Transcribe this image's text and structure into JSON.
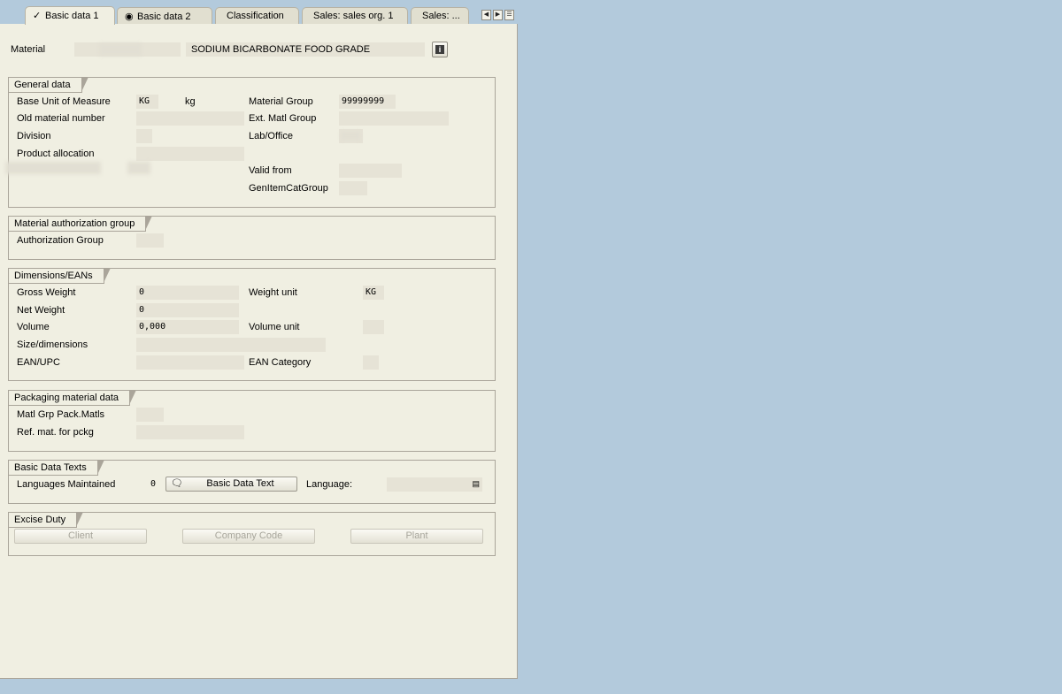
{
  "tabs": [
    {
      "label": "Basic data 1",
      "active": true,
      "icon": "check-gear-icon"
    },
    {
      "label": "Basic data 2",
      "icon": "target-gear-icon"
    },
    {
      "label": "Classification"
    },
    {
      "label": "Sales: sales org. 1"
    },
    {
      "label": "Sales: ..."
    }
  ],
  "header": {
    "material_label": "Material",
    "material_number": "",
    "material_description": "SODIUM BICARBONATE FOOD GRADE"
  },
  "general": {
    "title": "General data",
    "base_uom_label": "Base Unit of Measure",
    "base_uom": "KG",
    "base_uom_text": "kg",
    "material_group_label": "Material Group",
    "material_group": "99999999",
    "old_matnr_label": "Old material number",
    "ext_matl_group_label": "Ext. Matl Group",
    "division_label": "Division",
    "lab_office_label": "Lab/Office",
    "product_allocation_label": "Product allocation",
    "valid_from_label": "Valid from",
    "gen_item_cat_label": "GenItemCatGroup"
  },
  "auth": {
    "title": "Material authorization group",
    "auth_group_label": "Authorization Group"
  },
  "dimensions": {
    "title": "Dimensions/EANs",
    "gross_weight_label": "Gross Weight",
    "gross_weight": "0",
    "weight_unit_label": "Weight unit",
    "weight_unit": "KG",
    "net_weight_label": "Net Weight",
    "net_weight": "0",
    "volume_label": "Volume",
    "volume": "0,000",
    "volume_unit_label": "Volume unit",
    "size_label": "Size/dimensions",
    "ean_label": "EAN/UPC",
    "ean_category_label": "EAN Category"
  },
  "packaging": {
    "title": "Packaging material data",
    "matl_grp_pack_label": "Matl Grp Pack.Matls",
    "ref_mat_label": "Ref. mat. for pckg"
  },
  "texts": {
    "title": "Basic Data Texts",
    "languages_label": "Languages Maintained",
    "languages_count": "0",
    "button_label": "Basic Data Text",
    "language_label": "Language:"
  },
  "excise": {
    "title": "Excise Duty",
    "client_label": "Client",
    "company_code_label": "Company Code",
    "plant_label": "Plant"
  }
}
